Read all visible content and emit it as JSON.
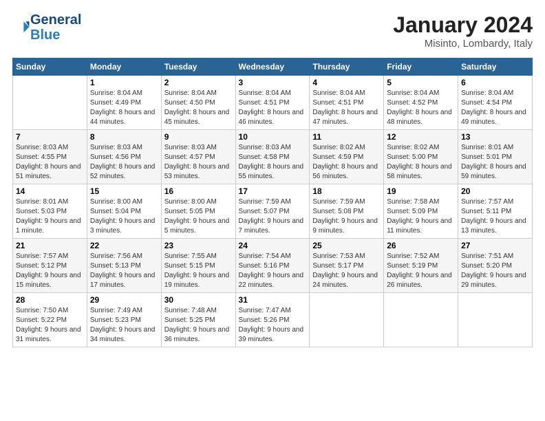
{
  "header": {
    "logo_line1": "General",
    "logo_line2": "Blue",
    "month_title": "January 2024",
    "location": "Misinto, Lombardy, Italy"
  },
  "days_of_week": [
    "Sunday",
    "Monday",
    "Tuesday",
    "Wednesday",
    "Thursday",
    "Friday",
    "Saturday"
  ],
  "weeks": [
    [
      {
        "day": "",
        "sunrise": "",
        "sunset": "",
        "daylight": ""
      },
      {
        "day": "1",
        "sunrise": "Sunrise: 8:04 AM",
        "sunset": "Sunset: 4:49 PM",
        "daylight": "Daylight: 8 hours and 44 minutes."
      },
      {
        "day": "2",
        "sunrise": "Sunrise: 8:04 AM",
        "sunset": "Sunset: 4:50 PM",
        "daylight": "Daylight: 8 hours and 45 minutes."
      },
      {
        "day": "3",
        "sunrise": "Sunrise: 8:04 AM",
        "sunset": "Sunset: 4:51 PM",
        "daylight": "Daylight: 8 hours and 46 minutes."
      },
      {
        "day": "4",
        "sunrise": "Sunrise: 8:04 AM",
        "sunset": "Sunset: 4:51 PM",
        "daylight": "Daylight: 8 hours and 47 minutes."
      },
      {
        "day": "5",
        "sunrise": "Sunrise: 8:04 AM",
        "sunset": "Sunset: 4:52 PM",
        "daylight": "Daylight: 8 hours and 48 minutes."
      },
      {
        "day": "6",
        "sunrise": "Sunrise: 8:04 AM",
        "sunset": "Sunset: 4:54 PM",
        "daylight": "Daylight: 8 hours and 49 minutes."
      }
    ],
    [
      {
        "day": "7",
        "sunrise": "Sunrise: 8:03 AM",
        "sunset": "Sunset: 4:55 PM",
        "daylight": "Daylight: 8 hours and 51 minutes."
      },
      {
        "day": "8",
        "sunrise": "Sunrise: 8:03 AM",
        "sunset": "Sunset: 4:56 PM",
        "daylight": "Daylight: 8 hours and 52 minutes."
      },
      {
        "day": "9",
        "sunrise": "Sunrise: 8:03 AM",
        "sunset": "Sunset: 4:57 PM",
        "daylight": "Daylight: 8 hours and 53 minutes."
      },
      {
        "day": "10",
        "sunrise": "Sunrise: 8:03 AM",
        "sunset": "Sunset: 4:58 PM",
        "daylight": "Daylight: 8 hours and 55 minutes."
      },
      {
        "day": "11",
        "sunrise": "Sunrise: 8:02 AM",
        "sunset": "Sunset: 4:59 PM",
        "daylight": "Daylight: 8 hours and 56 minutes."
      },
      {
        "day": "12",
        "sunrise": "Sunrise: 8:02 AM",
        "sunset": "Sunset: 5:00 PM",
        "daylight": "Daylight: 8 hours and 58 minutes."
      },
      {
        "day": "13",
        "sunrise": "Sunrise: 8:01 AM",
        "sunset": "Sunset: 5:01 PM",
        "daylight": "Daylight: 8 hours and 59 minutes."
      }
    ],
    [
      {
        "day": "14",
        "sunrise": "Sunrise: 8:01 AM",
        "sunset": "Sunset: 5:03 PM",
        "daylight": "Daylight: 9 hours and 1 minute."
      },
      {
        "day": "15",
        "sunrise": "Sunrise: 8:00 AM",
        "sunset": "Sunset: 5:04 PM",
        "daylight": "Daylight: 9 hours and 3 minutes."
      },
      {
        "day": "16",
        "sunrise": "Sunrise: 8:00 AM",
        "sunset": "Sunset: 5:05 PM",
        "daylight": "Daylight: 9 hours and 5 minutes."
      },
      {
        "day": "17",
        "sunrise": "Sunrise: 7:59 AM",
        "sunset": "Sunset: 5:07 PM",
        "daylight": "Daylight: 9 hours and 7 minutes."
      },
      {
        "day": "18",
        "sunrise": "Sunrise: 7:59 AM",
        "sunset": "Sunset: 5:08 PM",
        "daylight": "Daylight: 9 hours and 9 minutes."
      },
      {
        "day": "19",
        "sunrise": "Sunrise: 7:58 AM",
        "sunset": "Sunset: 5:09 PM",
        "daylight": "Daylight: 9 hours and 11 minutes."
      },
      {
        "day": "20",
        "sunrise": "Sunrise: 7:57 AM",
        "sunset": "Sunset: 5:11 PM",
        "daylight": "Daylight: 9 hours and 13 minutes."
      }
    ],
    [
      {
        "day": "21",
        "sunrise": "Sunrise: 7:57 AM",
        "sunset": "Sunset: 5:12 PM",
        "daylight": "Daylight: 9 hours and 15 minutes."
      },
      {
        "day": "22",
        "sunrise": "Sunrise: 7:56 AM",
        "sunset": "Sunset: 5:13 PM",
        "daylight": "Daylight: 9 hours and 17 minutes."
      },
      {
        "day": "23",
        "sunrise": "Sunrise: 7:55 AM",
        "sunset": "Sunset: 5:15 PM",
        "daylight": "Daylight: 9 hours and 19 minutes."
      },
      {
        "day": "24",
        "sunrise": "Sunrise: 7:54 AM",
        "sunset": "Sunset: 5:16 PM",
        "daylight": "Daylight: 9 hours and 22 minutes."
      },
      {
        "day": "25",
        "sunrise": "Sunrise: 7:53 AM",
        "sunset": "Sunset: 5:17 PM",
        "daylight": "Daylight: 9 hours and 24 minutes."
      },
      {
        "day": "26",
        "sunrise": "Sunrise: 7:52 AM",
        "sunset": "Sunset: 5:19 PM",
        "daylight": "Daylight: 9 hours and 26 minutes."
      },
      {
        "day": "27",
        "sunrise": "Sunrise: 7:51 AM",
        "sunset": "Sunset: 5:20 PM",
        "daylight": "Daylight: 9 hours and 29 minutes."
      }
    ],
    [
      {
        "day": "28",
        "sunrise": "Sunrise: 7:50 AM",
        "sunset": "Sunset: 5:22 PM",
        "daylight": "Daylight: 9 hours and 31 minutes."
      },
      {
        "day": "29",
        "sunrise": "Sunrise: 7:49 AM",
        "sunset": "Sunset: 5:23 PM",
        "daylight": "Daylight: 9 hours and 34 minutes."
      },
      {
        "day": "30",
        "sunrise": "Sunrise: 7:48 AM",
        "sunset": "Sunset: 5:25 PM",
        "daylight": "Daylight: 9 hours and 36 minutes."
      },
      {
        "day": "31",
        "sunrise": "Sunrise: 7:47 AM",
        "sunset": "Sunset: 5:26 PM",
        "daylight": "Daylight: 9 hours and 39 minutes."
      },
      {
        "day": "",
        "sunrise": "",
        "sunset": "",
        "daylight": ""
      },
      {
        "day": "",
        "sunrise": "",
        "sunset": "",
        "daylight": ""
      },
      {
        "day": "",
        "sunrise": "",
        "sunset": "",
        "daylight": ""
      }
    ]
  ]
}
